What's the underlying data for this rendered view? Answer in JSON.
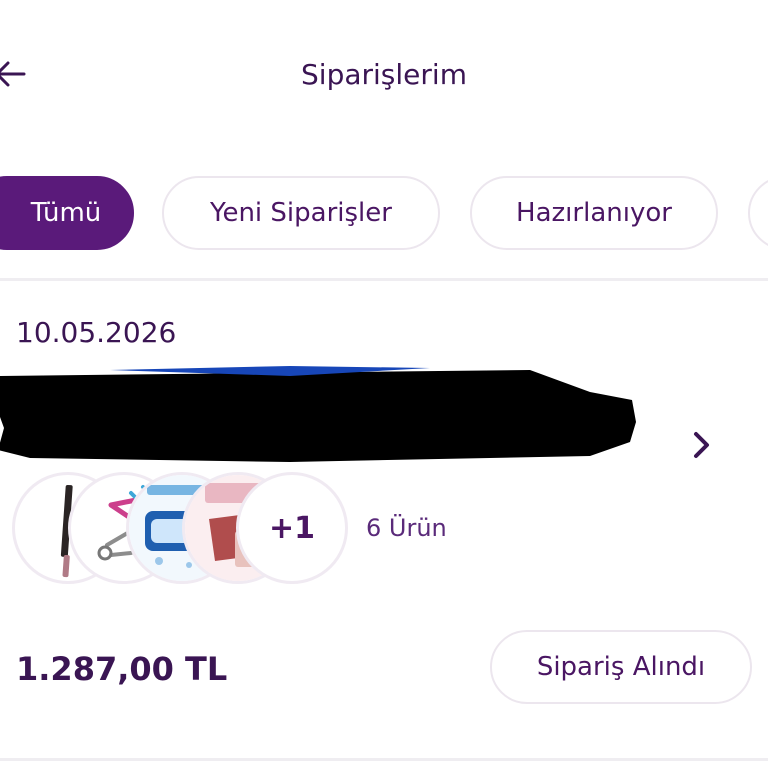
{
  "header": {
    "title": "Siparişlerim",
    "back_icon": "arrow-left-icon"
  },
  "tabs": [
    {
      "label": "Tümü",
      "active": true
    },
    {
      "label": "Yeni Siparişler",
      "active": false
    },
    {
      "label": "Hazırlanıyor",
      "active": false
    },
    {
      "label": "",
      "active": false
    }
  ],
  "order": {
    "date": "10.05.2026",
    "products": {
      "thumbnails": [
        "lip-pencil",
        "eyelash-curler",
        "collagen-eye-mask",
        "makeup-sponge"
      ],
      "more_label": "+1",
      "count_label": "6 Ürün"
    },
    "total": "1.287,00 TL",
    "status_label": "Sipariş Alındı"
  },
  "colors": {
    "brand_purple": "#5a1a7a",
    "text_dark": "#3a1553",
    "border": "#ece6ee",
    "redaction": "#000000"
  }
}
